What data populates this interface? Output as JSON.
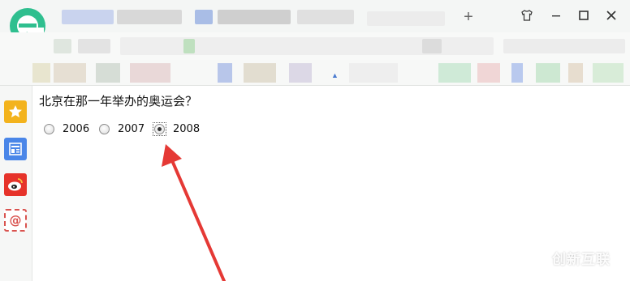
{
  "browser": {
    "logo_icon": "browser-e-logo-icon",
    "new_tab_label": "+",
    "window_controls": [
      "skin-icon",
      "minimize-icon",
      "maximize-icon",
      "close-icon"
    ],
    "accent_color": "#2fbf8f"
  },
  "sidebar": {
    "items": [
      {
        "icon": "star-icon",
        "color": "#f3b31d"
      },
      {
        "icon": "news-icon",
        "color": "#4a86e8"
      },
      {
        "icon": "weibo-icon",
        "color": "#e6332a"
      },
      {
        "icon": "mail-at-icon",
        "color": "#d9534f"
      }
    ]
  },
  "quiz": {
    "question": "北京在那一年举办的奥运会？",
    "options": [
      {
        "label": "2006",
        "checked": false
      },
      {
        "label": "2007",
        "checked": false
      },
      {
        "label": "2008",
        "checked": true
      }
    ]
  },
  "annotation": {
    "arrow_color": "#e53935"
  },
  "watermark": {
    "text": "创新互联"
  }
}
